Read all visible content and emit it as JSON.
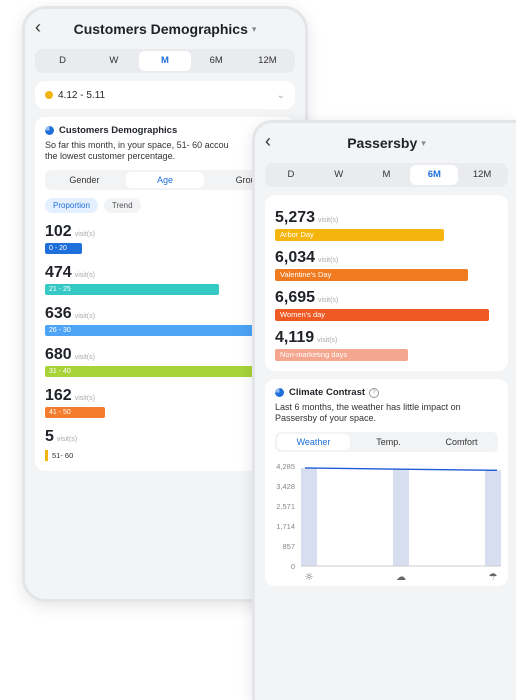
{
  "left": {
    "title": "Customers Demographics",
    "periods": [
      "D",
      "W",
      "M",
      "6M",
      "12M"
    ],
    "active_period": "M",
    "date_range": "4.12 - 5.11",
    "section_title": "Customers Demographics",
    "desc_line1": "So far this month, in your space, 51- 60 accou",
    "desc_line2": "the lowest customer percentage.",
    "tabs": [
      "Gender",
      "Age",
      "Grou"
    ],
    "active_tab": "Age",
    "chips": [
      "Proportion",
      "Trend"
    ],
    "unit": "visit(s)",
    "rows": [
      {
        "value": "102",
        "label": "0 - 20",
        "fraction": 0.15,
        "color": "#1e6fd9"
      },
      {
        "value": "474",
        "label": "21 - 25",
        "fraction": 0.7,
        "color": "#34c9c4"
      },
      {
        "value": "636",
        "label": "26 - 30",
        "fraction": 0.94,
        "color": "#4da3f5"
      },
      {
        "value": "680",
        "label": "31 - 40",
        "fraction": 1.0,
        "color": "#a8d339"
      },
      {
        "value": "162",
        "label": "41 - 50",
        "fraction": 0.24,
        "color": "#f37d2c"
      },
      {
        "value": "5",
        "label": "51- 60",
        "fraction": 0.0,
        "color": "#f3b40e"
      }
    ]
  },
  "right": {
    "title": "Passersby",
    "periods": [
      "D",
      "W",
      "M",
      "6M",
      "12M"
    ],
    "active_period": "6M",
    "unit": "visit(s)",
    "rows": [
      {
        "value": "5,273",
        "label": "Arbor Day",
        "fraction": 0.79,
        "color": "#f5b50f"
      },
      {
        "value": "6,034",
        "label": "Valentine's Day",
        "fraction": 0.9,
        "color": "#f07a1f"
      },
      {
        "value": "6,695",
        "label": "Women's day",
        "fraction": 1.0,
        "color": "#ef5a24"
      },
      {
        "value": "4,119",
        "label": "Non-marketing days",
        "fraction": 0.62,
        "color": "#f4a68f"
      }
    ],
    "climate_title": "Climate Contrast",
    "climate_desc": "Last 6 months, the weather has little impact on Passersby of your space.",
    "climate_tabs": [
      "Weather",
      "Temp.",
      "Comfort"
    ],
    "active_climate_tab": "Weather"
  },
  "chart_data": {
    "type": "bar",
    "categories": [
      "sunny",
      "cloudy",
      "rainy"
    ],
    "icons": [
      "sun-icon",
      "cloud-sun-icon",
      "rain-icon"
    ],
    "series": [
      {
        "values": [
          4200,
          4150,
          4100
        ]
      }
    ],
    "line_values": [
      4200,
      4150,
      4100
    ],
    "yticks": [
      "0",
      "857",
      "1,714",
      "2,571",
      "3,428",
      "4,285"
    ],
    "ylim": [
      0,
      4285
    ],
    "colors": {
      "bar": "#d6def0",
      "line": "#1e5bd8"
    }
  }
}
